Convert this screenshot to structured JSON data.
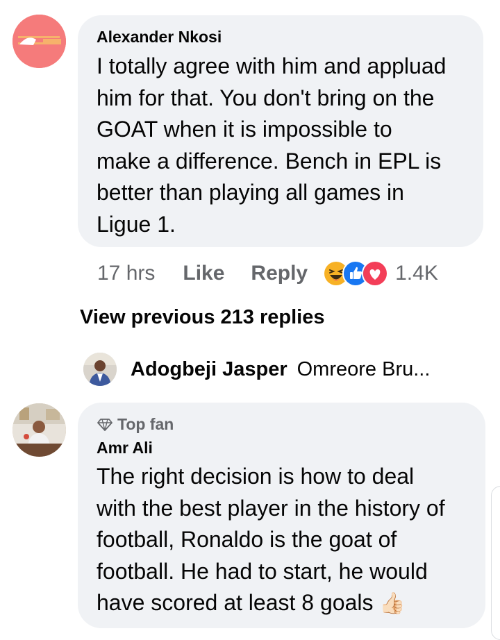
{
  "comment1": {
    "author": "Alexander Nkosi",
    "text": "I totally agree with him and appluad\nhim for that. You don't bring on the\nGOAT when it is impossible to\nmake a difference. Bench in EPL is\nbetter than playing all games in\nLigue 1.",
    "time": "17 hrs",
    "like_label": "Like",
    "reply_label": "Reply",
    "reaction_icons": [
      "haha-reaction-icon",
      "like-reaction-icon",
      "love-reaction-icon"
    ],
    "reaction_count": "1.4K",
    "avatar_color": "#f57b7b"
  },
  "view_previous_label": "View previous 213 replies",
  "reply_preview": {
    "author": "Adogbeji Jasper",
    "snippet": "Omreore Bru..."
  },
  "comment2": {
    "badge_icon": "diamond-icon",
    "badge_label": "Top fan",
    "author": "Amr Ali",
    "text": "The right decision is how to deal\nwith the best player in the history of\nfootball, Ronaldo is the goat of\nfootball. He had to start, he would\nhave scored at least 8 goals",
    "trailing_emoji": "👍🏻"
  },
  "colors": {
    "bubble": "#f0f2f5",
    "meta_text": "#65676b",
    "like_blue": "#1877f2",
    "love_red": "#f33e58",
    "haha_yellow": "#f7b125"
  }
}
